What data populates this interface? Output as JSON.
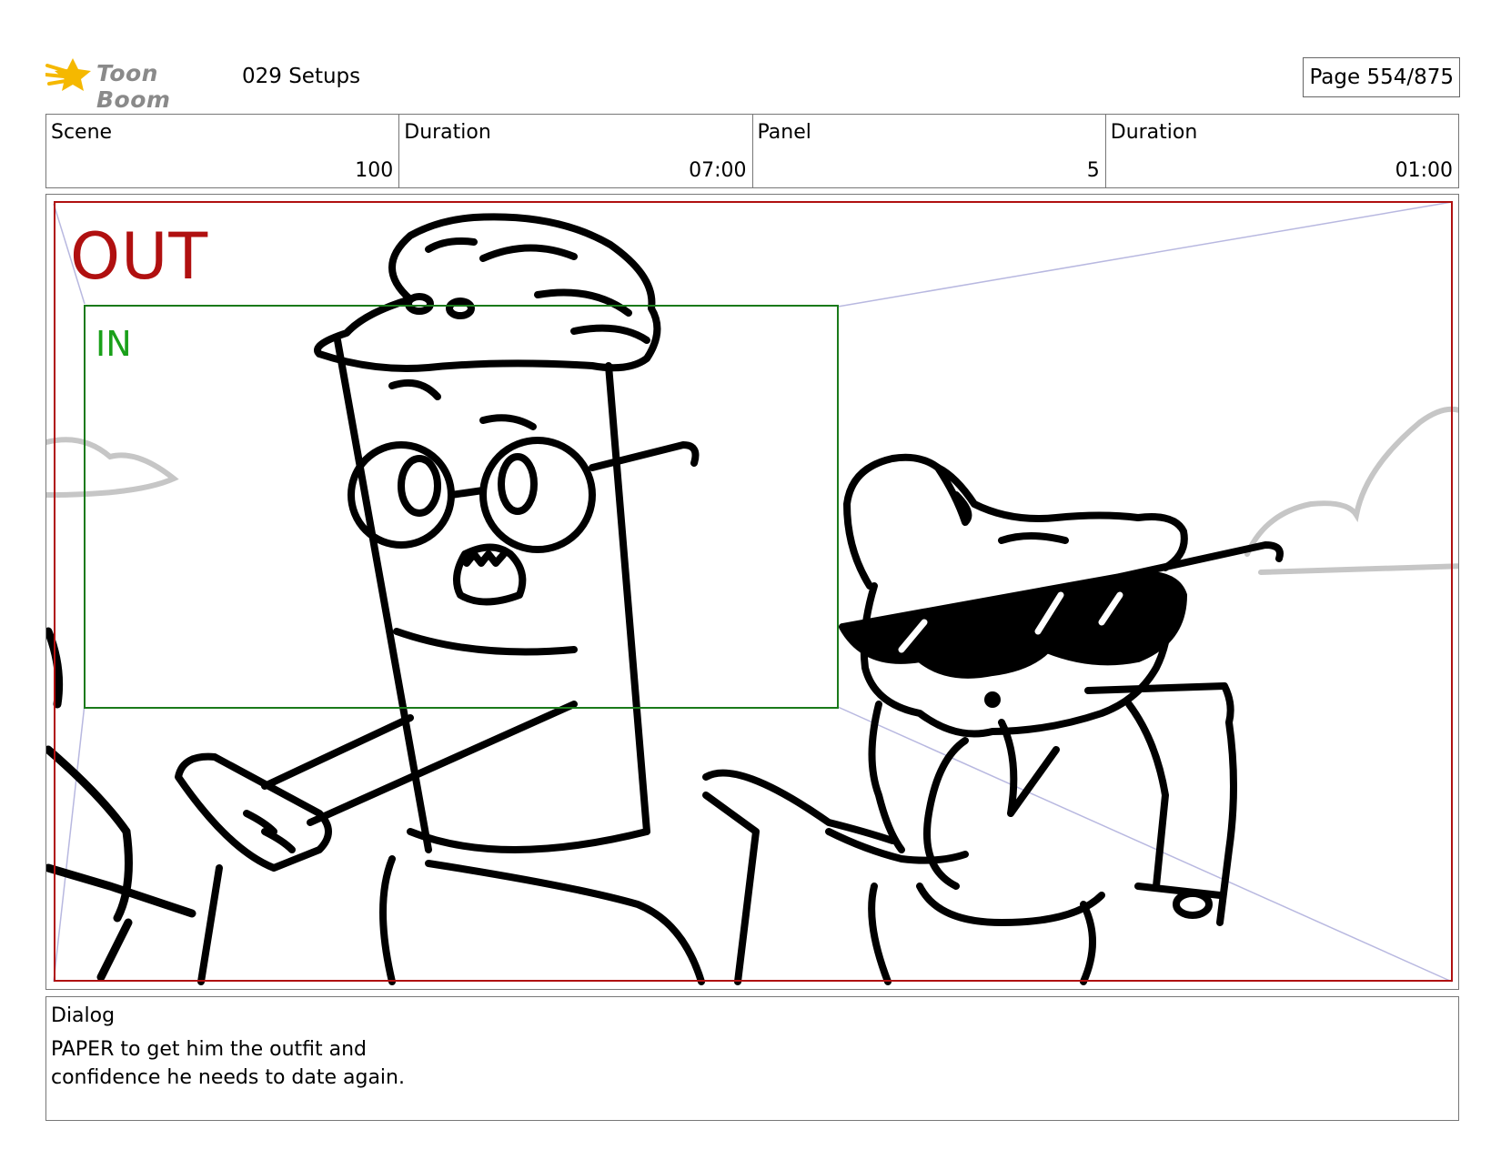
{
  "header": {
    "logo_text": "Toon Boom",
    "project_title": "029 Setups",
    "page_label": "Page 554/875"
  },
  "info": {
    "scene_label": "Scene",
    "scene_value": "100",
    "scene_duration_label": "Duration",
    "scene_duration_value": "07:00",
    "panel_label": "Panel",
    "panel_value": "5",
    "panel_duration_label": "Duration",
    "panel_duration_value": "01:00"
  },
  "panel": {
    "out_label": "OUT",
    "in_label": "IN"
  },
  "dialog": {
    "label": "Dialog",
    "lines": [
      "PAPER to get him the outfit and",
      "confidence he needs to date again."
    ]
  },
  "colors": {
    "out_frame": "#b01010",
    "in_frame": "#1a7a1a",
    "in_text": "#1aa01a",
    "logo_star": "#f5b800"
  }
}
